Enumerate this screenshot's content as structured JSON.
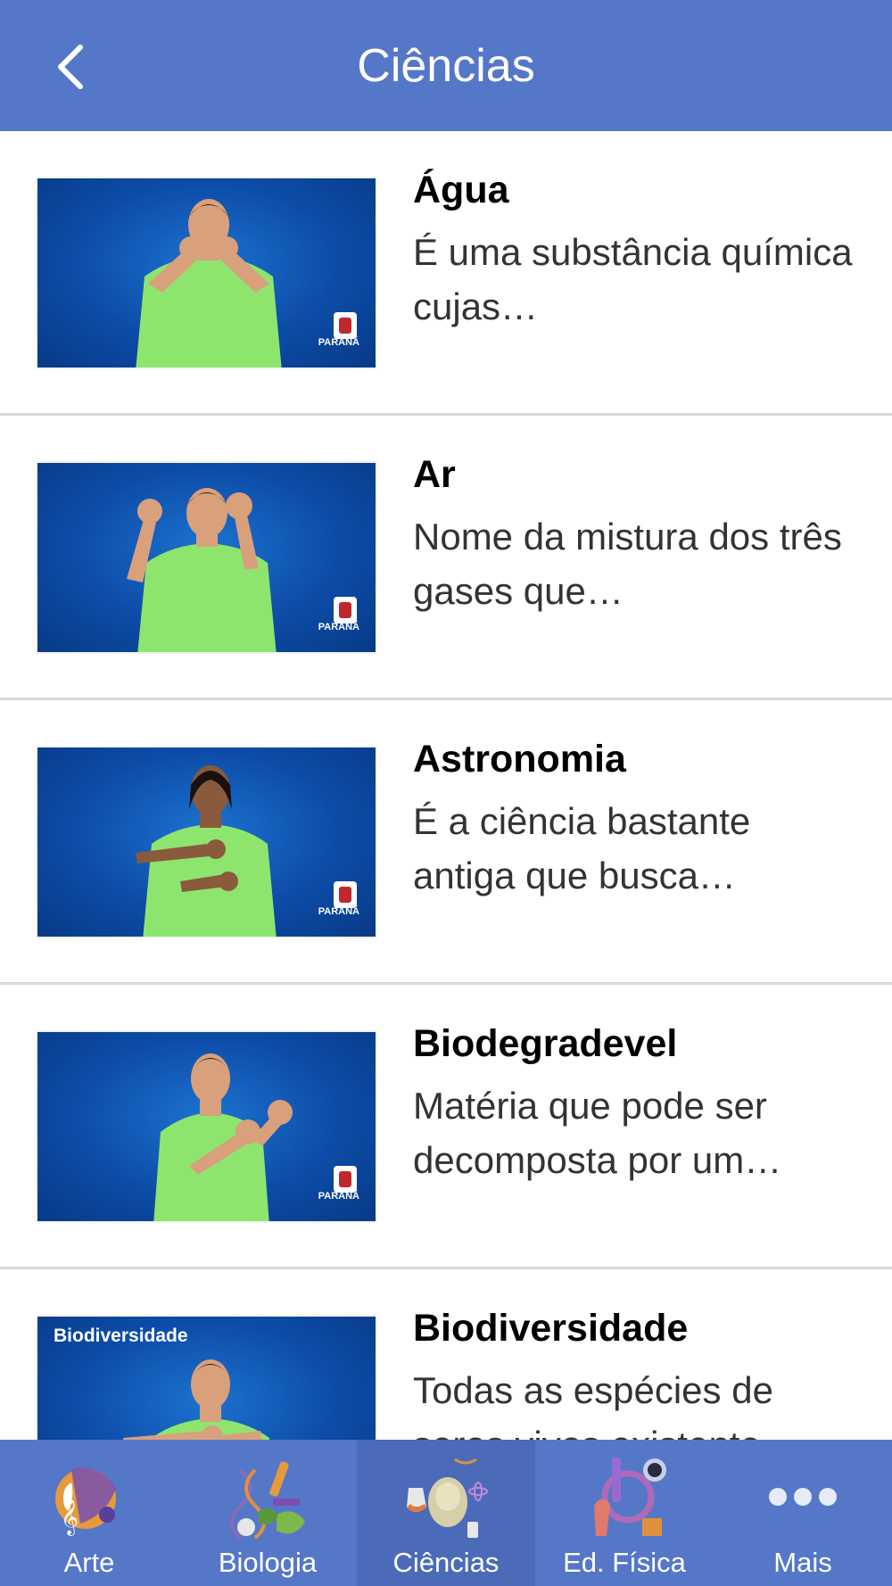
{
  "header": {
    "title": "Ciências",
    "back_icon": "chevron-left-icon"
  },
  "items": [
    {
      "title": "Água",
      "description": "É uma substância química cujas…",
      "thumbnail_caption": ""
    },
    {
      "title": "Ar",
      "description": "Nome da mistura dos três gases que…",
      "thumbnail_caption": ""
    },
    {
      "title": "Astronomia",
      "description": "É a ciência bastante antiga que busca…",
      "thumbnail_caption": ""
    },
    {
      "title": "Biodegradevel",
      "description": "Matéria que pode ser decomposta por um…",
      "thumbnail_caption": ""
    },
    {
      "title": "Biodiversidade",
      "description": "Todas as espécies de seres vivos existente…",
      "thumbnail_caption": "Biodiversidade"
    }
  ],
  "thumbnail_seal": "PARANÁ",
  "tabs": [
    {
      "label": "Arte",
      "icon": "art-icon",
      "active": false
    },
    {
      "label": "Biologia",
      "icon": "dna-microscope-icon",
      "active": false
    },
    {
      "label": "Ciências",
      "icon": "science-head-icon",
      "active": true
    },
    {
      "label": "Ed. Física",
      "icon": "physical-education-icon",
      "active": false
    },
    {
      "label": "Mais",
      "icon": "more-dots-icon",
      "active": false
    }
  ],
  "colors": {
    "header": "#5577c8",
    "tabbar": "#5577c8",
    "tab_active": "#4b6bb9",
    "thumbnail_bg": "#0c4ca8",
    "shirt": "#8ee56e"
  }
}
